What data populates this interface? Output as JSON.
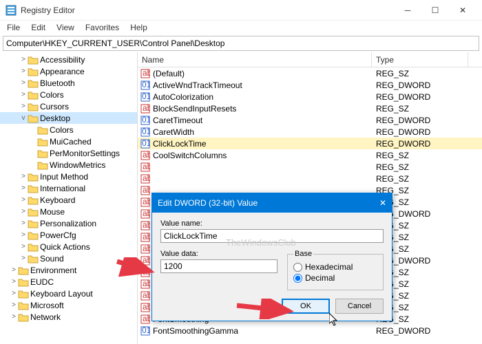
{
  "window": {
    "title": "Registry Editor",
    "menus": [
      "File",
      "Edit",
      "View",
      "Favorites",
      "Help"
    ],
    "address": "Computer\\HKEY_CURRENT_USER\\Control Panel\\Desktop"
  },
  "tree": [
    {
      "d": 2,
      "exp": ">",
      "label": "Accessibility"
    },
    {
      "d": 2,
      "exp": ">",
      "label": "Appearance"
    },
    {
      "d": 2,
      "exp": ">",
      "label": "Bluetooth"
    },
    {
      "d": 2,
      "exp": ">",
      "label": "Colors"
    },
    {
      "d": 2,
      "exp": ">",
      "label": "Cursors"
    },
    {
      "d": 2,
      "exp": "v",
      "label": "Desktop",
      "sel": true
    },
    {
      "d": 3,
      "exp": "",
      "label": "Colors"
    },
    {
      "d": 3,
      "exp": "",
      "label": "MuiCached"
    },
    {
      "d": 3,
      "exp": "",
      "label": "PerMonitorSettings"
    },
    {
      "d": 3,
      "exp": "",
      "label": "WindowMetrics"
    },
    {
      "d": 2,
      "exp": ">",
      "label": "Input Method"
    },
    {
      "d": 2,
      "exp": ">",
      "label": "International"
    },
    {
      "d": 2,
      "exp": ">",
      "label": "Keyboard"
    },
    {
      "d": 2,
      "exp": ">",
      "label": "Mouse"
    },
    {
      "d": 2,
      "exp": ">",
      "label": "Personalization"
    },
    {
      "d": 2,
      "exp": ">",
      "label": "PowerCfg"
    },
    {
      "d": 2,
      "exp": ">",
      "label": "Quick Actions"
    },
    {
      "d": 2,
      "exp": ">",
      "label": "Sound"
    },
    {
      "d": 1,
      "exp": ">",
      "label": "Environment"
    },
    {
      "d": 1,
      "exp": ">",
      "label": "EUDC"
    },
    {
      "d": 1,
      "exp": ">",
      "label": "Keyboard Layout"
    },
    {
      "d": 1,
      "exp": ">",
      "label": "Microsoft"
    },
    {
      "d": 1,
      "exp": ">",
      "label": "Network"
    }
  ],
  "list": {
    "columns": {
      "name": "Name",
      "type": "Type"
    },
    "rows": [
      {
        "icon": "sz",
        "name": "(Default)",
        "type": "REG_SZ"
      },
      {
        "icon": "dw",
        "name": "ActiveWndTrackTimeout",
        "type": "REG_DWORD"
      },
      {
        "icon": "dw",
        "name": "AutoColorization",
        "type": "REG_DWORD"
      },
      {
        "icon": "sz",
        "name": "BlockSendInputResets",
        "type": "REG_SZ"
      },
      {
        "icon": "dw",
        "name": "CaretTimeout",
        "type": "REG_DWORD"
      },
      {
        "icon": "dw",
        "name": "CaretWidth",
        "type": "REG_DWORD"
      },
      {
        "icon": "dw",
        "name": "ClickLockTime",
        "type": "REG_DWORD",
        "sel": true
      },
      {
        "icon": "sz",
        "name": "CoolSwitchColumns",
        "type": "REG_SZ"
      },
      {
        "icon": "sz",
        "name": "",
        "type": "REG_SZ"
      },
      {
        "icon": "sz",
        "name": "",
        "type": "REG_SZ"
      },
      {
        "icon": "sz",
        "name": "",
        "type": "REG_SZ"
      },
      {
        "icon": "sz",
        "name": "",
        "type": "REG_SZ"
      },
      {
        "icon": "sz",
        "name": "",
        "type": "REG_DWORD"
      },
      {
        "icon": "sz",
        "name": "",
        "type": "REG_SZ"
      },
      {
        "icon": "sz",
        "name": "",
        "type": "REG_SZ"
      },
      {
        "icon": "sz",
        "name": "",
        "type": "REG_SZ"
      },
      {
        "icon": "sz",
        "name": "",
        "type": "REG_DWORD"
      },
      {
        "icon": "sz",
        "name": "",
        "type": "REG_SZ"
      },
      {
        "icon": "sz",
        "name": "",
        "type": "REG_SZ"
      },
      {
        "icon": "sz",
        "name": "",
        "type": "REG_SZ"
      },
      {
        "icon": "sz",
        "name": "",
        "type": "REG_SZ"
      },
      {
        "icon": "sz",
        "name": "FontSmoothing",
        "type": "REG_SZ"
      },
      {
        "icon": "dw",
        "name": "FontSmoothingGamma",
        "type": "REG_DWORD"
      }
    ]
  },
  "dialog": {
    "title": "Edit DWORD (32-bit) Value",
    "close": "✕",
    "valuename_label": "Value name:",
    "valuename": "ClickLockTime",
    "valuedata_label": "Value data:",
    "valuedata": "1200",
    "base_label": "Base",
    "hex": "Hexadecimal",
    "dec": "Decimal",
    "selected_base": "Decimal",
    "ok": "OK",
    "cancel": "Cancel"
  },
  "watermark": "TheWindowsClub"
}
